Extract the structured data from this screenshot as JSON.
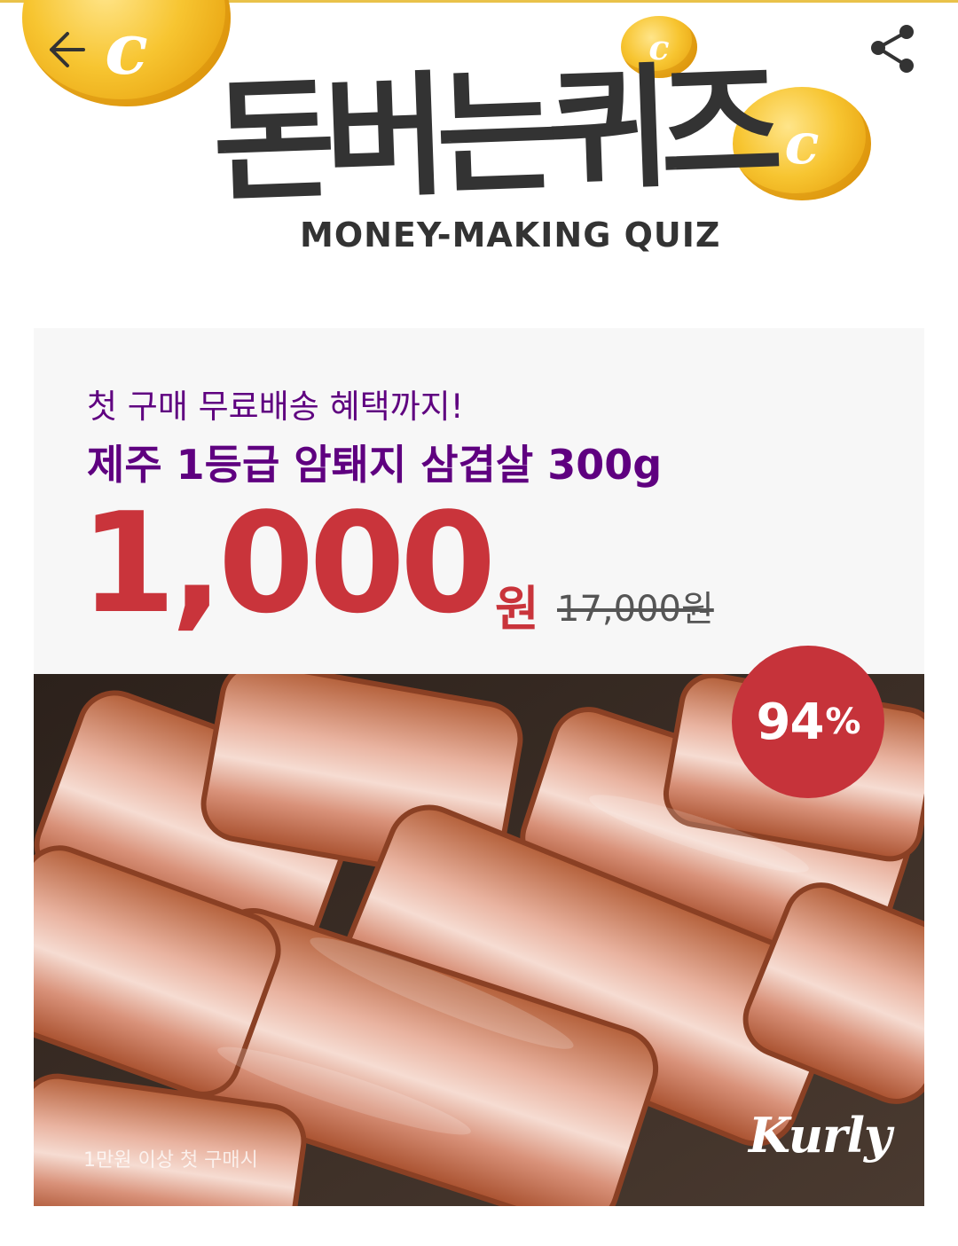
{
  "header": {
    "title_ko": "돈버는퀴즈",
    "title_en": "MONEY-MAKING QUIZ",
    "coin_letter": "c"
  },
  "promo": {
    "subtitle": "첫 구매 무료배송 혜택까지!",
    "product_name": "제주 1등급 암퇘지 삼겹살 300g",
    "price": "1,000",
    "price_unit": "원",
    "original_price": "17,000원",
    "discount_value": "94",
    "discount_unit": "%",
    "footnote": "1만원 이상 첫 구매시",
    "brand": "Kurly"
  },
  "colors": {
    "accent_purple": "#5f0080",
    "price_red": "#c9343b",
    "coin_gold": "#f7c531",
    "title_dark": "#333333"
  },
  "icons": {
    "back": "arrow-left-icon",
    "share": "share-icon",
    "coin": "coin-icon"
  }
}
